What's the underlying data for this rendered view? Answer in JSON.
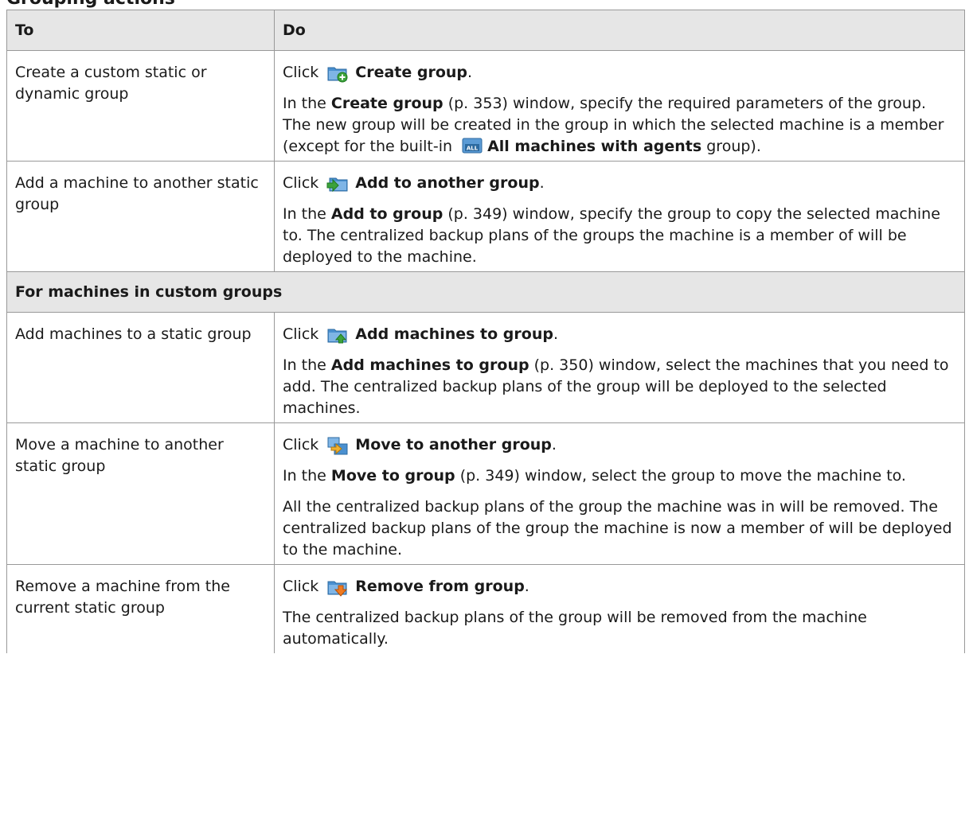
{
  "heading": "Grouping actions",
  "headers": {
    "to": "To",
    "do": "Do"
  },
  "click_word": "Click",
  "rows": [
    {
      "to": "Create a custom static or dynamic group",
      "cmd": "Create group",
      "icon": "create-group-icon",
      "p1": {
        "a": "In the ",
        "b": "Create group",
        "c": " (p. 353) window, specify the required parameters of the group. The new group will be created in the group in which the selected machine is a member (except for the built-in ",
        "icon": "all-machines-icon",
        "d": "All machines with agents",
        "e": " group)."
      }
    },
    {
      "to": "Add a machine to another static group",
      "cmd": "Add to another group",
      "icon": "add-to-group-icon",
      "p1": {
        "a": "In the ",
        "b": "Add to group",
        "c": " (p. 349) window, specify the group to copy the selected machine to. The centralized backup plans of the groups the machine is a member of will be deployed to the machine."
      }
    }
  ],
  "section": "For machines in custom groups",
  "rows2": [
    {
      "to": "Add machines to a static group",
      "cmd": "Add machines to group",
      "icon": "add-machines-icon",
      "p1": {
        "a": "In the ",
        "b": "Add machines to group",
        "c": " (p. 350) window, select the machines that you need to add. The centralized backup plans of the group will be deployed to the selected machines."
      }
    },
    {
      "to": "Move a machine to another static group",
      "cmd": "Move to another group",
      "icon": "move-to-group-icon",
      "p1": {
        "a": "In the ",
        "b": "Move to group",
        "c": " (p. 349) window, select the group to move the machine to."
      },
      "p2": "All the centralized backup plans of the group the machine was in will be removed. The centralized backup plans of the group the machine is now a member of will be deployed to the machine."
    },
    {
      "to": "Remove a machine from the current static group",
      "cmd": "Remove from group",
      "icon": "remove-from-group-icon",
      "p1": {
        "a": "The centralized backup plans of the group will be removed from the machine automatically."
      }
    }
  ],
  "colors": {
    "header_bg": "#e6e6e6",
    "border": "#999999"
  }
}
